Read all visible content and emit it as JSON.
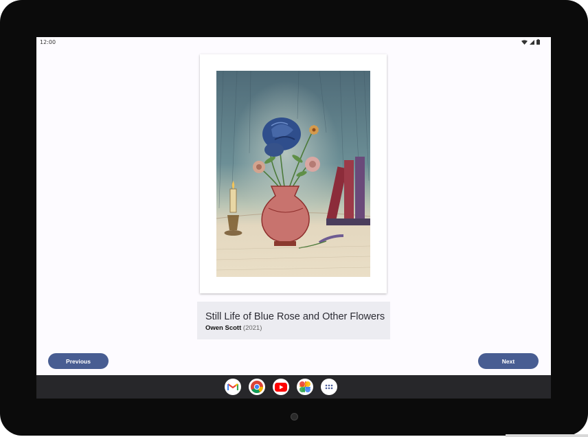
{
  "status_bar": {
    "time": "12:00",
    "icons": [
      "wifi-icon",
      "cellular-signal-icon",
      "battery-icon"
    ]
  },
  "artwork": {
    "image_description_icon": "still-life-drawing",
    "title": "Still Life of Blue Rose and Other Flowers",
    "artist": "Owen Scott",
    "year": "(2021)"
  },
  "navigation": {
    "previous_label": "Previous",
    "next_label": "Next"
  },
  "taskbar": {
    "apps": [
      {
        "name": "gmail-icon"
      },
      {
        "name": "chrome-icon"
      },
      {
        "name": "youtube-icon"
      },
      {
        "name": "photos-icon"
      },
      {
        "name": "app-drawer-icon"
      }
    ]
  },
  "colors": {
    "button": "#485d92",
    "caption_bg": "#ececf1",
    "screen_bg": "#fdfbff",
    "taskbar": "#27272a"
  }
}
